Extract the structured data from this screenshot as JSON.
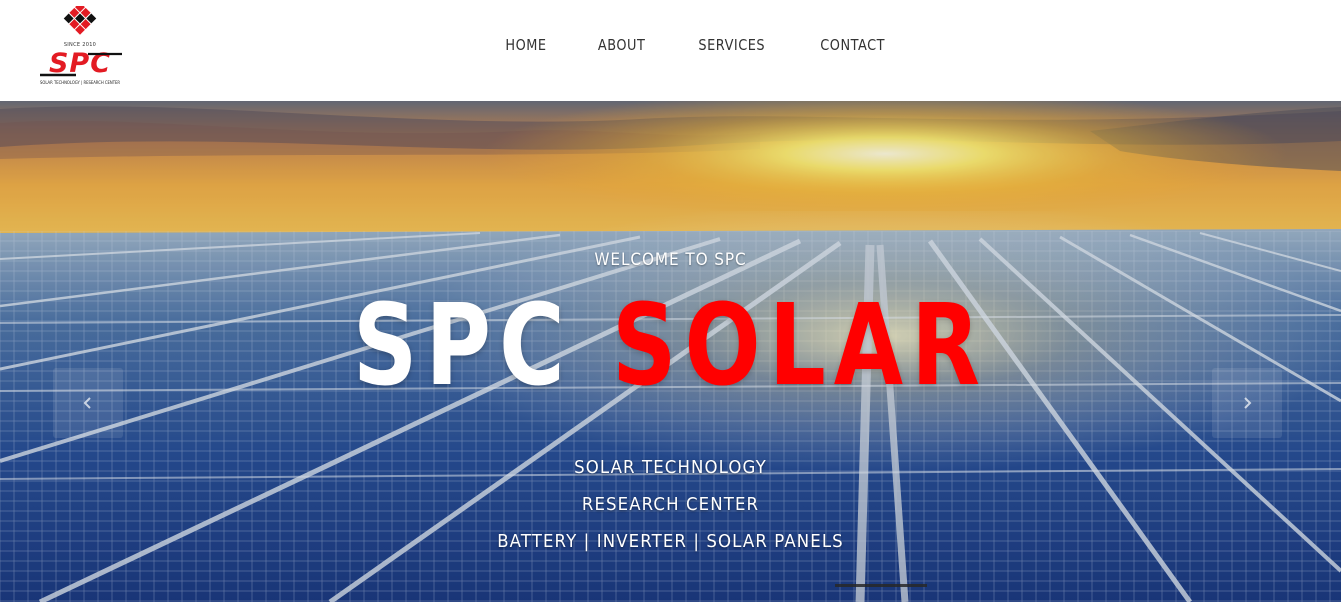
{
  "brand": {
    "since": "SINCE 2010",
    "wordmark": "SPC",
    "tagline": "SOLAR TECHNOLOGY   |   RESEARCH CENTER",
    "colors": {
      "red": "#e31b23",
      "black": "#111111"
    }
  },
  "nav": {
    "items": [
      {
        "label": "HOME"
      },
      {
        "label": "ABOUT"
      },
      {
        "label": "SERVICES"
      },
      {
        "label": "CONTACT"
      }
    ]
  },
  "hero": {
    "kicker": "WELCOME TO SPC",
    "title_part1": "SPC",
    "title_part2": "SOLAR",
    "lines": [
      "SOLAR TECHNOLOGY",
      "RESEARCH CENTER",
      "BATTERY | INVERTER | SOLAR PANELS"
    ],
    "colors": {
      "accent": "#ff0000",
      "text": "#ffffff"
    }
  },
  "carousel": {
    "prev_icon": "chevron-left-icon",
    "next_icon": "chevron-right-icon",
    "indicator_count": 1,
    "active_index": 0
  }
}
